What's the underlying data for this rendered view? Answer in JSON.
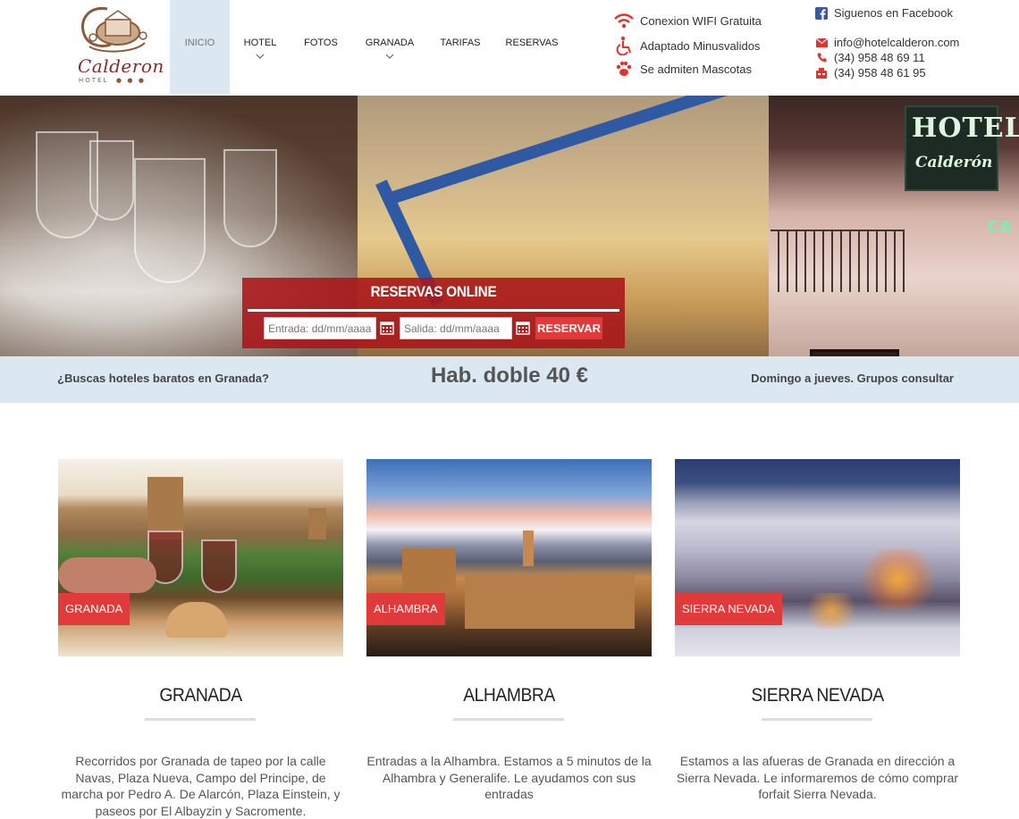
{
  "logo": {
    "word": "Calderon",
    "sub": "HOTEL",
    "stars": "● ● ●"
  },
  "nav": [
    {
      "label": "INICIO",
      "has_dropdown": false,
      "active": true
    },
    {
      "label": "HOTEL",
      "has_dropdown": true,
      "active": false
    },
    {
      "label": "FOTOS",
      "has_dropdown": false,
      "active": false
    },
    {
      "label": "GRANADA",
      "has_dropdown": true,
      "active": false
    },
    {
      "label": "TARIFAS",
      "has_dropdown": false,
      "active": false
    },
    {
      "label": "RESERVAS",
      "has_dropdown": false,
      "active": false
    }
  ],
  "features": [
    {
      "icon": "wifi-icon",
      "label": "Conexion WIFI Gratuita"
    },
    {
      "icon": "wheelchair-icon",
      "label": "Adaptado Minusvalidos"
    },
    {
      "icon": "paw-icon",
      "label": "Se admiten Mascotas"
    }
  ],
  "contact": {
    "facebook": "Siguenos en Facebook",
    "email": "info@hotelcalderon.com",
    "phone": "(34) 958 48 69 11",
    "fax": "(34) 958 48 61 95"
  },
  "hero": {
    "sign_line1": "HOTEL",
    "sign_line2": "Calderón",
    "sign_side": "CA"
  },
  "booking": {
    "title": "RESERVAS ONLINE",
    "checkin_placeholder": "Entrada: dd/mm/aaaa",
    "checkout_placeholder": "Salida: dd/mm/aaaa",
    "button": "RESERVAR"
  },
  "promo": {
    "left": "¿Buscas hoteles baratos en Granada?",
    "center": "Hab. doble 40 €",
    "right": "Domingo a jueves. Grupos consultar"
  },
  "cards": [
    {
      "tag": "GRANADA",
      "title": "GRANADA",
      "text": "Recorridos por Granada de tapeo por la calle Navas, Plaza Nueva, Campo del Principe, de marcha por Pedro A. De Alarcón, Plaza Einstein, y paseos por El Albayzin y Sacromente."
    },
    {
      "tag": "ALHAMBRA",
      "title": "ALHAMBRA",
      "text": "Entradas a la Alhambra. Estamos a 5 minutos de la Alhambra y Generalife. Le ayudamos con sus entradas"
    },
    {
      "tag": "SIERRA NEVADA",
      "title": "SIERRA NEVADA",
      "text": "Estamos a las afueras de Granada en dirección a Sierra Nevada. Le informaremos de cómo comprar forfait Sierra Nevada."
    }
  ],
  "colors": {
    "accent": "#e03a3a",
    "promo_bg": "#dbe8f1",
    "facebook": "#3b5998"
  }
}
